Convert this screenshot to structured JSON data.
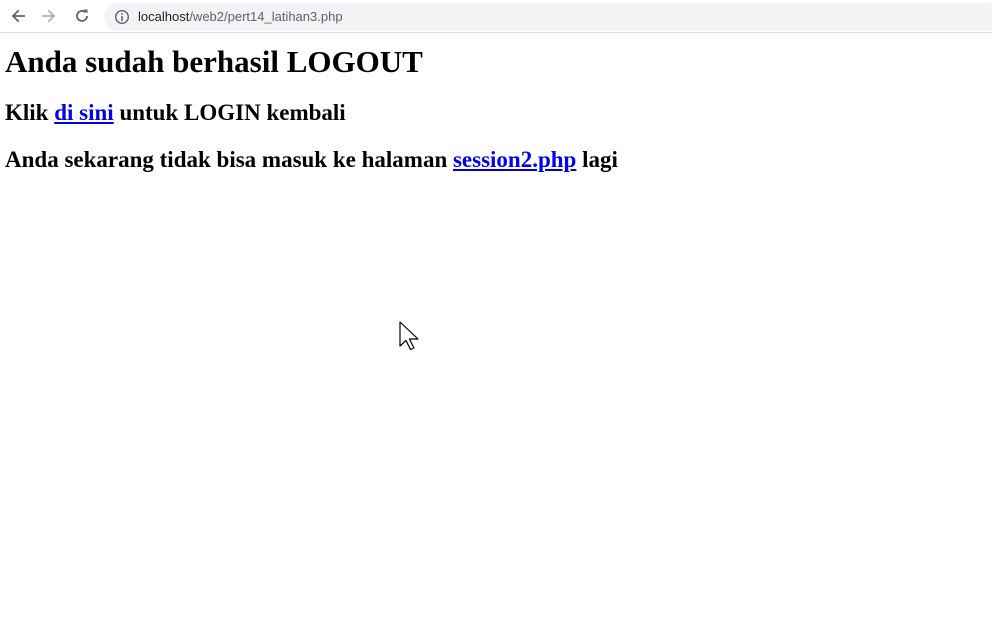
{
  "browser": {
    "url_host": "localhost",
    "url_path": "/web2/pert14_latihan3.php"
  },
  "page": {
    "heading": "Anda sudah berhasil LOGOUT",
    "line1": {
      "prefix": "Klik ",
      "link": "di sini",
      "suffix": " untuk LOGIN kembali"
    },
    "line2": {
      "prefix": "Anda sekarang tidak bisa masuk ke halaman ",
      "link": "session2.php",
      "suffix": " lagi"
    }
  },
  "icons": {
    "back": "arrow-left-icon",
    "forward": "arrow-right-icon",
    "reload": "reload-icon",
    "site_info": "info-icon",
    "cursor": "mouse-pointer-icon"
  },
  "colors": {
    "link": "#0000ee",
    "text": "#000000",
    "omnibox_bg": "#f1f3f4"
  }
}
